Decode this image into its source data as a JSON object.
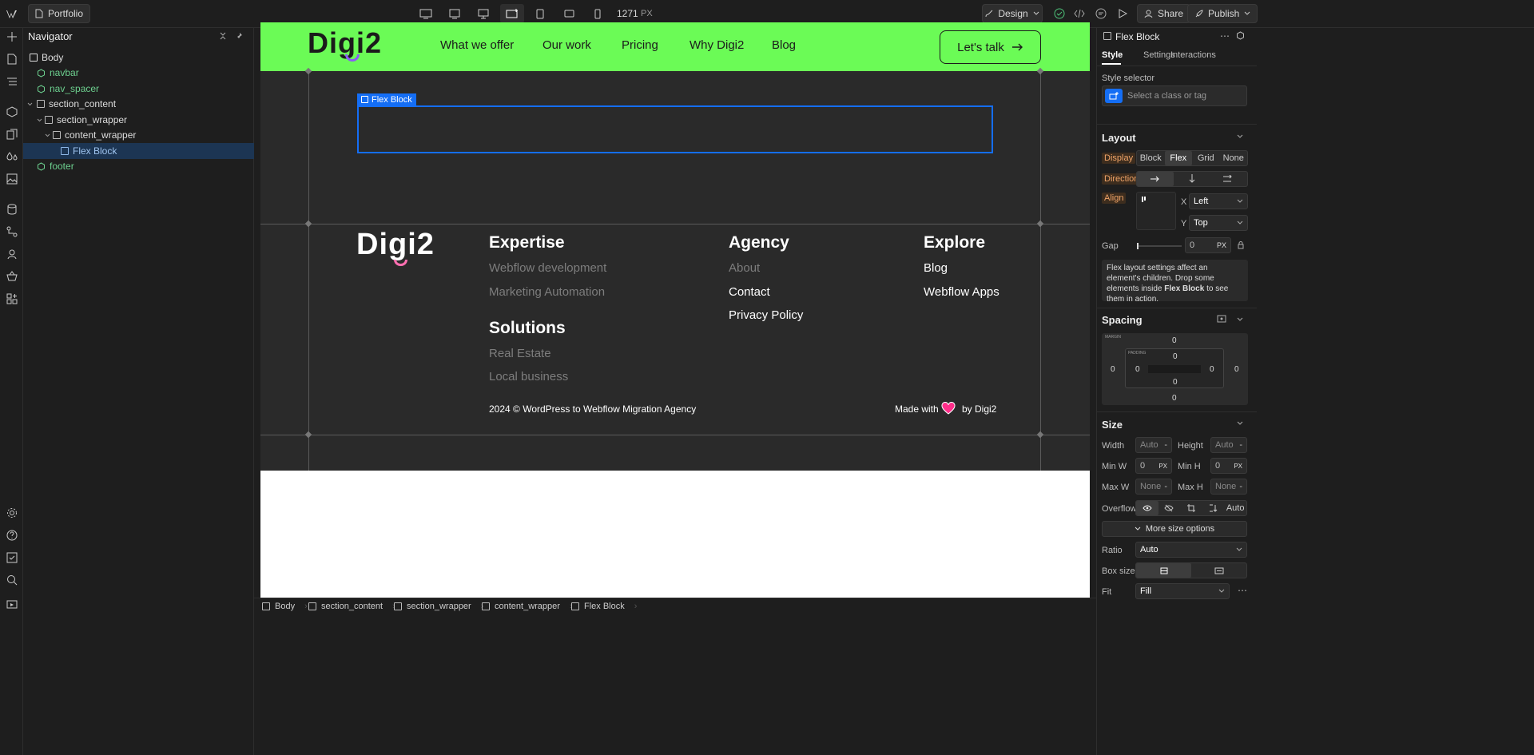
{
  "topbar": {
    "page_name": "Portfolio",
    "width_value": "1271",
    "width_unit": "PX",
    "mode_label": "Design",
    "share_label": "Share",
    "publish_label": "Publish"
  },
  "navigator": {
    "title": "Navigator",
    "items": [
      {
        "label": "Body",
        "type": "element"
      },
      {
        "label": "navbar",
        "type": "symbol"
      },
      {
        "label": "nav_spacer",
        "type": "symbol"
      },
      {
        "label": "section_content",
        "type": "element"
      },
      {
        "label": "section_wrapper",
        "type": "element"
      },
      {
        "label": "content_wrapper",
        "type": "element"
      },
      {
        "label": "Flex Block",
        "type": "element",
        "selected": true
      },
      {
        "label": "footer",
        "type": "symbol"
      }
    ]
  },
  "site": {
    "logo": "Digi2",
    "menu": [
      "What we offer",
      "Our work",
      "Pricing",
      "Why Digi2",
      "Blog"
    ],
    "cta": "Let's talk",
    "selection_tag": "Flex Block",
    "footer": {
      "logo": "Digi2",
      "expertise_title": "Expertise",
      "expertise_links": [
        "Webflow development",
        "Marketing Automation"
      ],
      "solutions_title": "Solutions",
      "solutions_links": [
        "Real Estate",
        "Local business"
      ],
      "agency_title": "Agency",
      "agency_links": [
        "About",
        "Contact",
        "Privacy Policy"
      ],
      "explore_title": "Explore",
      "explore_links": [
        "Blog",
        "Webflow Apps"
      ],
      "copyright": "2024 © WordPress to Webflow Migration Agency",
      "made_with": "Made with",
      "by": "by Digi2"
    }
  },
  "panel": {
    "element_name": "Flex Block",
    "tabs": [
      "Style",
      "Settings",
      "Interactions"
    ],
    "style_selector_label": "Style selector",
    "style_selector_placeholder": "Select a class or tag",
    "layout": {
      "title": "Layout",
      "display_label": "Display",
      "display_options": [
        "Block",
        "Flex",
        "Grid",
        "None"
      ],
      "direction_label": "Direction",
      "align_label": "Align",
      "x_label": "X",
      "x_value": "Left",
      "y_label": "Y",
      "y_value": "Top",
      "gap_label": "Gap",
      "gap_value": "0",
      "gap_unit": "PX",
      "info_pre": "Flex layout settings affect an element's children. Drop some elements inside ",
      "info_bold": "Flex Block",
      "info_post": " to see them in action."
    },
    "spacing": {
      "title": "Spacing",
      "margin_label": "MARGIN",
      "padding_label": "PADDING",
      "margin": {
        "top": "0",
        "right": "0",
        "bottom": "0",
        "left": "0"
      },
      "padding": {
        "top": "0",
        "right": "0",
        "bottom": "0",
        "left": "0"
      }
    },
    "size": {
      "title": "Size",
      "width_label": "Width",
      "width_value": "Auto",
      "height_label": "Height",
      "height_value": "Auto",
      "minw_label": "Min W",
      "minw_value": "0",
      "minw_unit": "PX",
      "minh_label": "Min H",
      "minh_value": "0",
      "minh_unit": "PX",
      "maxw_label": "Max W",
      "maxw_value": "None",
      "maxh_label": "Max H",
      "maxh_value": "None",
      "overflow_label": "Overflow",
      "overflow_auto": "Auto",
      "more_label": "More size options",
      "ratio_label": "Ratio",
      "ratio_value": "Auto",
      "boxsize_label": "Box size",
      "fit_label": "Fit",
      "fit_value": "Fill"
    }
  },
  "breadcrumbs": [
    "Body",
    "section_content",
    "section_wrapper",
    "content_wrapper",
    "Flex Block"
  ],
  "colors": {
    "accent": "#146ef5",
    "site_green": "#6bfb56",
    "logo_purple": "#8b5cf6",
    "heart": "#ff2e8a"
  }
}
